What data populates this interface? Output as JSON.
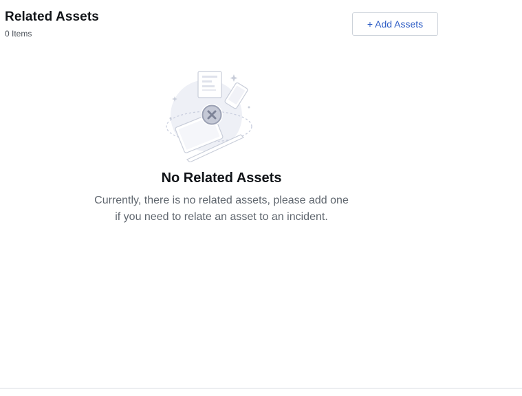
{
  "header": {
    "title": "Related Assets",
    "count": "0 Items"
  },
  "actions": {
    "add_assets_label": "+ Add Assets"
  },
  "empty_state": {
    "illustration_icon": "empty-assets-illustration",
    "title": "No Related Assets",
    "description": "Currently, there is no related assets, please add one if you need to relate an asset to an incident."
  },
  "colors": {
    "accent": "#2c5cc5",
    "title_text": "#111418",
    "muted_text": "#5f666e",
    "border": "#cdd3da"
  }
}
